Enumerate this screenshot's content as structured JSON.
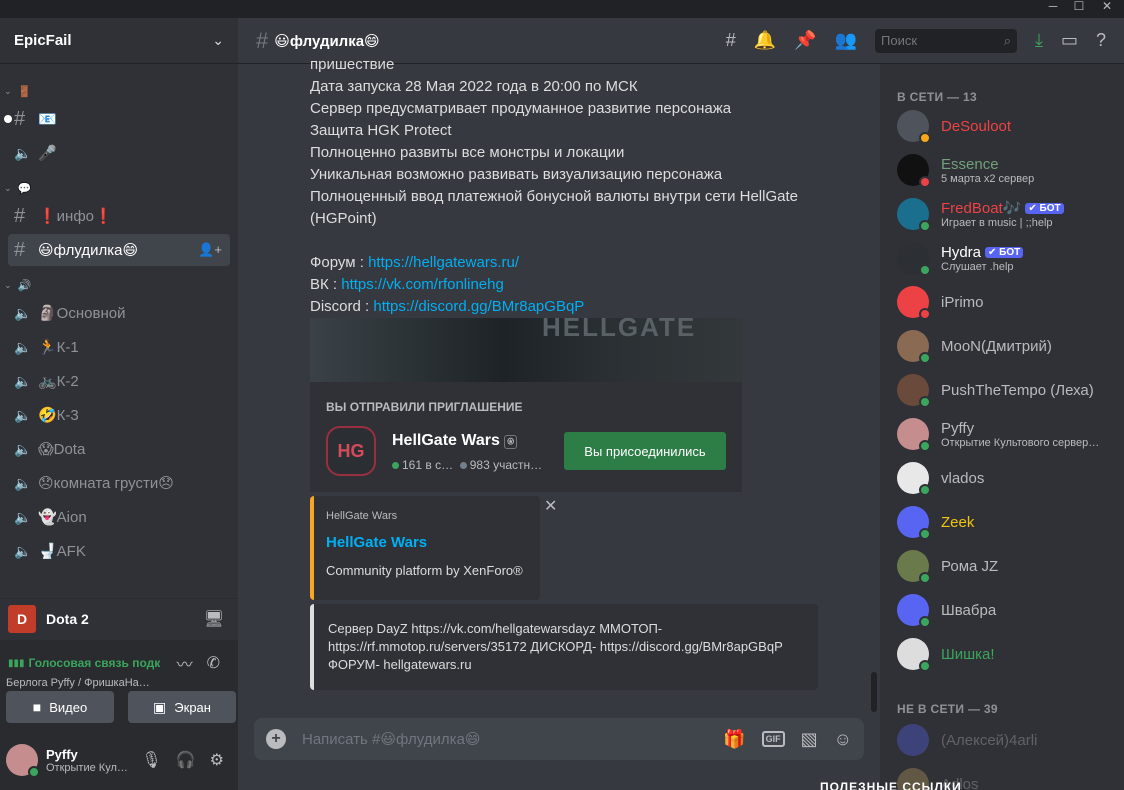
{
  "window": {
    "minimize": "─",
    "maximize": "☐",
    "close": "✕"
  },
  "guild": {
    "name": "EpicFail",
    "chevron": "⌄"
  },
  "categories": [
    {
      "label": "🚪"
    },
    {
      "label": "💬"
    },
    {
      "label": "🔊"
    }
  ],
  "channels": [
    {
      "name": "📧",
      "type": "text"
    },
    {
      "name": "🎤",
      "type": "voice"
    },
    {
      "name": "❗инфо❗",
      "type": "text"
    },
    {
      "name": "😃флудилка😄",
      "type": "text",
      "active": true
    },
    {
      "name": "🗿Основной",
      "type": "voice"
    },
    {
      "name": "🏃К-1",
      "type": "voice"
    },
    {
      "name": "🚲К-2",
      "type": "voice"
    },
    {
      "name": "🤣К-3",
      "type": "voice"
    },
    {
      "name": "😱Dota",
      "type": "voice"
    },
    {
      "name": "😞комната грусти😞",
      "type": "voice"
    },
    {
      "name": "👻Aion",
      "type": "voice"
    },
    {
      "name": "🚽AFK",
      "type": "voice"
    }
  ],
  "activity": {
    "name": "Dota 2"
  },
  "voice_panel": {
    "status": "Голосовая связь подк",
    "location": "Берлога Pyffy / ФришкаНа…",
    "video_label": "Видео",
    "screen_label": "Экран"
  },
  "user_panel": {
    "name": "Pyffy",
    "status": "Открытие Кул…"
  },
  "topbar": {
    "title": "😃флудилка😄",
    "search_placeholder": "Поиск"
  },
  "messages": {
    "lines": [
      "пришествие",
      "Дата запуска 28 Мая 2022 года в 20:00 по МСК",
      "Сервер предусматривает продуманное развитие персонажа",
      "Защита HGK Protect",
      "Полноценно развиты все монстры и локации",
      "Уникальная возможно развивать визуализацию персонажа",
      "Полноценный ввод платежной бонусной валюты внутри сети HellGate",
      "(HGPoint)"
    ],
    "forum_label": "Форум : ",
    "forum_url": "https://hellgatewars.ru/",
    "vk_label": "ВК : ",
    "vk_url": "https://vk.com/rfonlinehg",
    "discord_label": "Discord : ",
    "discord_url": "https://discord.gg/BMr8apGBqP"
  },
  "embed_image_text": "HELLGATE",
  "invite": {
    "label": "ВЫ ОТПРАВИЛИ ПРИГЛАШЕНИЕ",
    "name": "HellGate Wars",
    "online": "161 в с…",
    "members": "983 участн…",
    "button": "Вы присоединились",
    "icon_text": "HG"
  },
  "link_embed": {
    "provider": "HellGate Wars",
    "title": "HellGate Wars",
    "description": "Community platform by XenForo®"
  },
  "text_embed": {
    "text": "Сервер DayZ https://vk.com/hellgatewarsdayz ММОТОП- https://rf.mmotop.ru/servers/35172 ДИСКОРД- https://discord.gg/BMr8apGBqP ФОРУМ- hellgatewars.ru"
  },
  "composer": {
    "placeholder": "Написать #😃флудилка😄",
    "gif": "GIF"
  },
  "members": {
    "online_header": "В СЕТИ — 13",
    "offline_header": "НЕ В СЕТИ — 39",
    "online": [
      {
        "name": "DeSouloot",
        "color": "#ed4245",
        "sub": "",
        "status": "#faa61a",
        "avatar": "#4f545c"
      },
      {
        "name": "Essence",
        "color": "#72a07a",
        "sub": "5 марта x2 сервер",
        "status": "#ed4245",
        "avatar": "#111111"
      },
      {
        "name": "FredBoat🎶",
        "color": "#ed4245",
        "sub": "Играет в music | ;;help",
        "status": "#3ba55d",
        "avatar": "#1a6f8f",
        "bot": "✔ БОТ"
      },
      {
        "name": "Hydra",
        "color": "#ffffff",
        "sub": "Слушает .help",
        "status": "#3ba55d",
        "avatar": "#2c2f33",
        "bot": "✔ БОТ"
      },
      {
        "name": "iPrimo",
        "color": "#b9bbbe",
        "sub": "",
        "status": "#ed4245",
        "avatar": "#ed4245"
      },
      {
        "name": "MooN(Дмитрий)",
        "color": "#b9bbbe",
        "sub": "",
        "status": "#3ba55d",
        "avatar": "#8a6a52"
      },
      {
        "name": "PushTheTempo (Леха)",
        "color": "#b9bbbe",
        "sub": "",
        "status": "#3ba55d",
        "avatar": "#6a4a3a"
      },
      {
        "name": "Pyffy",
        "color": "#b9bbbe",
        "sub": "Открытие Культового сервер…",
        "status": "#3ba55d",
        "avatar": "#c58d8d"
      },
      {
        "name": "vlados",
        "color": "#b9bbbe",
        "sub": "",
        "status": "#3ba55d",
        "avatar": "#e8e8e8"
      },
      {
        "name": "Zeek",
        "color": "#f1c40f",
        "sub": "",
        "status": "#3ba55d",
        "avatar": "#5865f2"
      },
      {
        "name": "Рома JZ",
        "color": "#b9bbbe",
        "sub": "",
        "status": "#3ba55d",
        "avatar": "#6b7a4a"
      },
      {
        "name": "Швабра",
        "color": "#b9bbbe",
        "sub": "",
        "status": "#3ba55d",
        "avatar": "#5865f2"
      },
      {
        "name": "Шишка!",
        "color": "#3ba55d",
        "sub": "",
        "status": "#3ba55d",
        "avatar": "#dddddd"
      }
    ],
    "offline": [
      {
        "name": "(Алексей)4arli",
        "avatar": "#5865f2"
      },
      {
        "name": "Adlos",
        "avatar": "#c0a060"
      }
    ]
  },
  "bottom_cut_text": "ПОЛЕЗНЫЕ ССЫЛКИ"
}
